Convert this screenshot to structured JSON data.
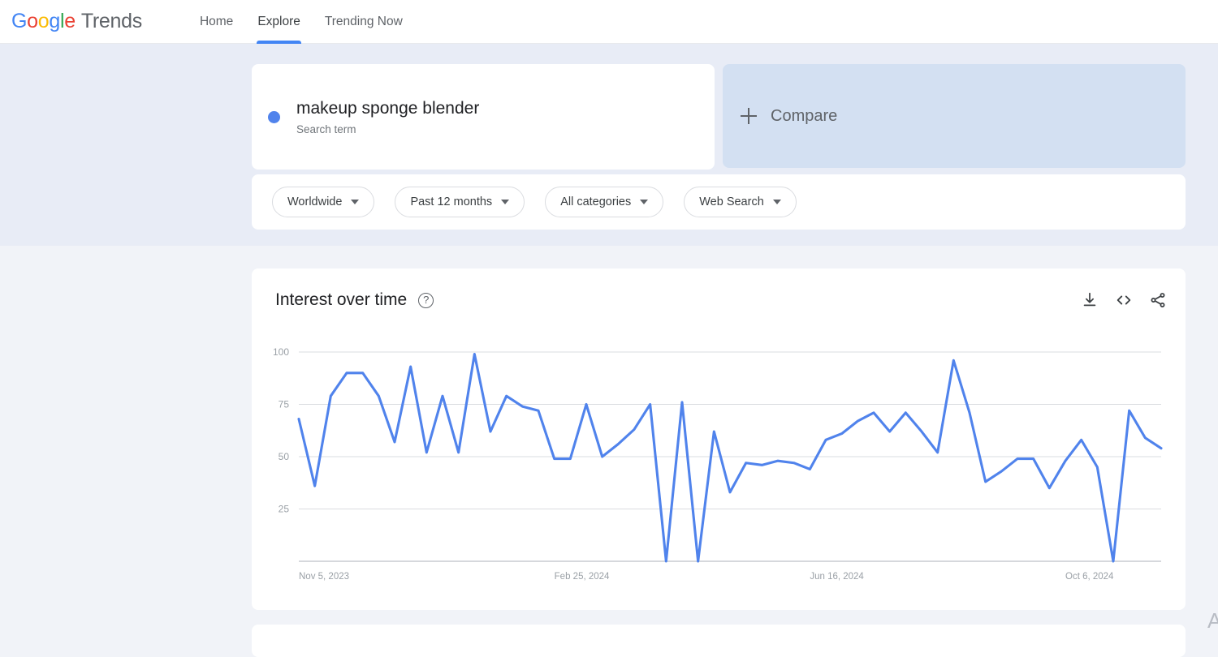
{
  "brand": {
    "google_letters": [
      "G",
      "o",
      "o",
      "g",
      "l",
      "e"
    ],
    "product": "Trends"
  },
  "nav": {
    "items": [
      {
        "label": "Home",
        "active": false
      },
      {
        "label": "Explore",
        "active": true
      },
      {
        "label": "Trending Now",
        "active": false
      }
    ]
  },
  "search_term": {
    "title": "makeup sponge blender",
    "subtitle": "Search term",
    "dot_color": "#5083EC"
  },
  "compare": {
    "label": "Compare",
    "icon": "plus-icon",
    "background": "#d3e0f2"
  },
  "filters": [
    {
      "label": "Worldwide"
    },
    {
      "label": "Past 12 months"
    },
    {
      "label": "All categories"
    },
    {
      "label": "Web Search"
    }
  ],
  "chart_card": {
    "title": "Interest over time",
    "help_glyph": "?",
    "actions": [
      {
        "name": "download-icon"
      },
      {
        "name": "embed-code-icon"
      },
      {
        "name": "share-icon"
      }
    ]
  },
  "chart_data": {
    "type": "line",
    "title": "Interest over time",
    "xlabel": "",
    "ylabel": "",
    "ylim": [
      0,
      100
    ],
    "yticks": [
      25,
      50,
      75,
      100
    ],
    "grid": true,
    "legend": false,
    "line_color": "#5083EC",
    "x_tick_labels": [
      "Nov 5, 2023",
      "Feb 25, 2024",
      "Jun 16, 2024",
      "Oct 6, 2024"
    ],
    "x_tick_indices": [
      0,
      16,
      32,
      48
    ],
    "series": [
      {
        "name": "makeup sponge blender",
        "color": "#5083EC",
        "values": [
          68,
          36,
          79,
          90,
          90,
          79,
          57,
          93,
          52,
          79,
          52,
          99,
          62,
          79,
          74,
          72,
          49,
          49,
          75,
          50,
          56,
          63,
          75,
          0,
          76,
          0,
          62,
          33,
          47,
          46,
          48,
          47,
          44,
          58,
          61,
          67,
          71,
          62,
          71,
          62,
          52,
          96,
          71,
          38,
          43,
          49,
          49,
          35,
          48,
          58,
          45,
          0,
          72,
          59,
          54
        ]
      }
    ]
  }
}
